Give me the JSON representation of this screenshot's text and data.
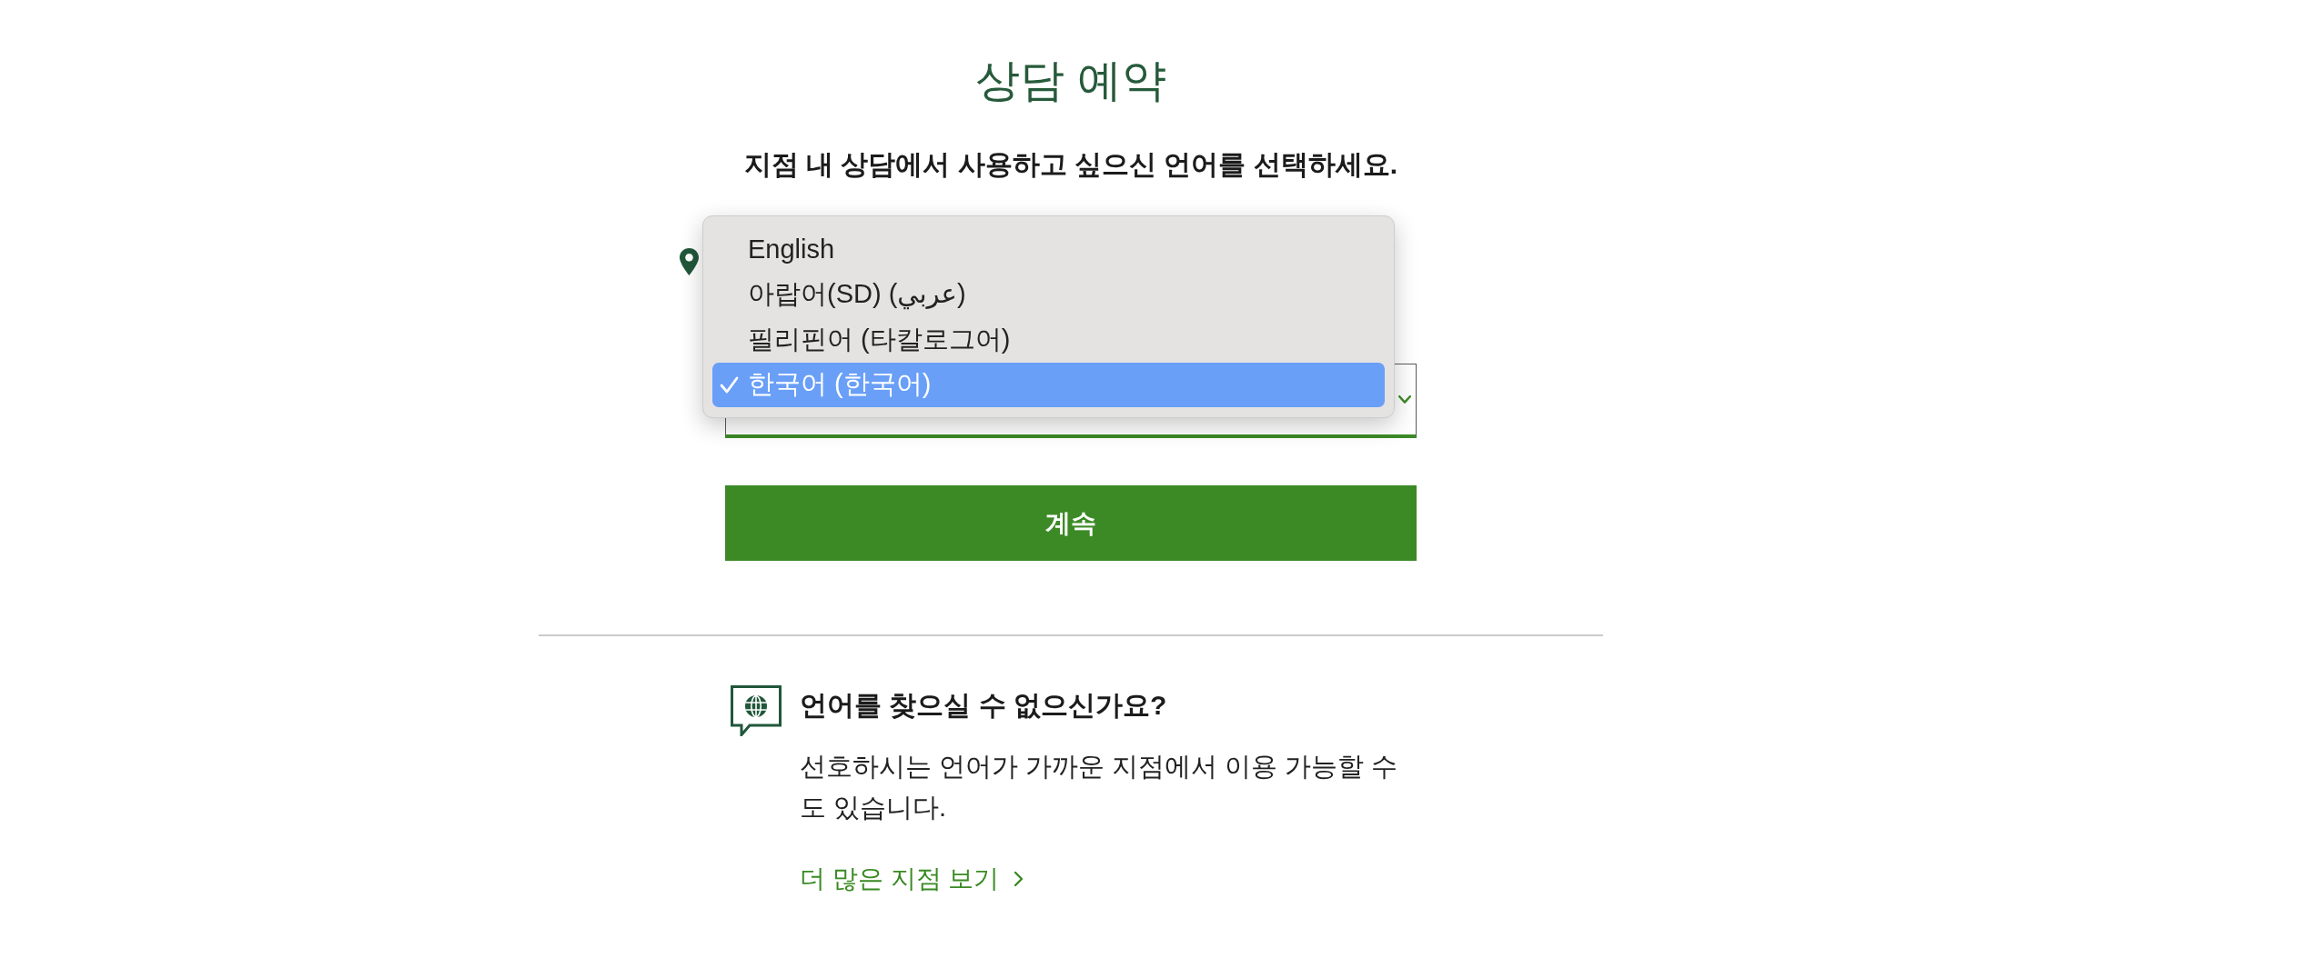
{
  "title": "상담 예약",
  "subtitle": "지점 내 상담에서 사용하고 싶으신 언어를 선택하세요.",
  "language_select": {
    "expanded": true,
    "options": [
      {
        "label": "English",
        "selected": false
      },
      {
        "label": "아랍어(SD) (عربي)",
        "selected": false
      },
      {
        "label": "필리핀어 (타칼로그어)",
        "selected": false
      },
      {
        "label": "한국어 (한국어)",
        "selected": true
      }
    ]
  },
  "continue_button": "계속",
  "help": {
    "heading": "언어를 찾으실 수 없으신가요?",
    "text_lines": [
      "선호하시는 언어가 가까운 지점에서 이용 가능할 수",
      "도 있습니다."
    ],
    "link": "더 많은 지점 보기"
  }
}
